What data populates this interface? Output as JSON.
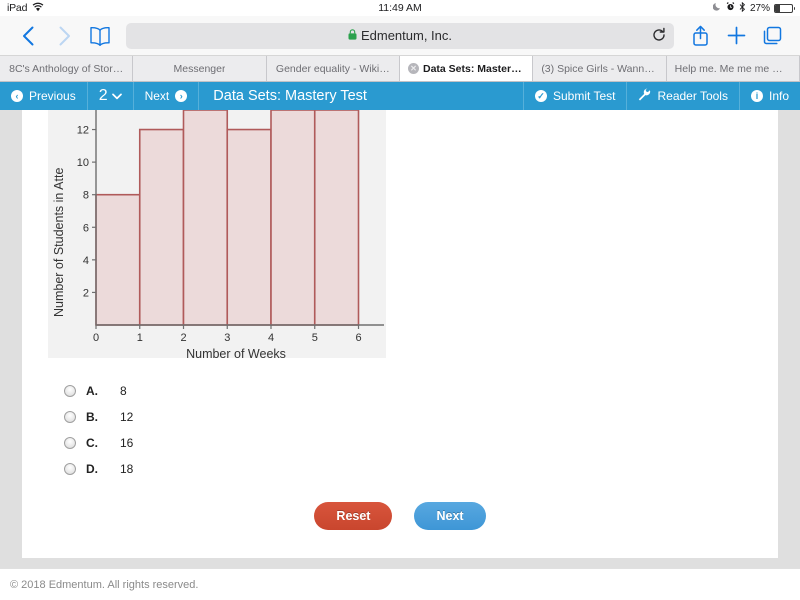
{
  "status_bar": {
    "device": "iPad",
    "wifi_icon": "wifi-icon",
    "time": "11:49 AM",
    "moon_icon": "moon-icon",
    "alarm_icon": "alarm-icon",
    "bluetooth_icon": "bluetooth-icon",
    "battery_percent": "27%",
    "battery_level": 27
  },
  "browser": {
    "back_icon": "chevron-left-icon",
    "forward_icon": "chevron-right-icon",
    "bookmarks_icon": "book-icon",
    "lock_icon": "lock-icon",
    "url_text": "Edmentum, Inc.",
    "reload_icon": "reload-icon",
    "share_icon": "share-icon",
    "newtab_icon": "plus-icon",
    "tabs_icon": "tabs-icon",
    "tabs": [
      {
        "label": "8C's Anthology of Stor…",
        "active": false,
        "has_close": false
      },
      {
        "label": "Messenger",
        "active": false,
        "has_close": false
      },
      {
        "label": "Gender equality - Wiki…",
        "active": false,
        "has_close": false
      },
      {
        "label": "Data Sets: Mastery…",
        "active": true,
        "has_close": true
      },
      {
        "label": "(3) Spice Girls - Wanna…",
        "active": false,
        "has_close": false
      },
      {
        "label": "Help me. Me me me m…",
        "active": false,
        "has_close": false
      }
    ]
  },
  "app_toolbar": {
    "accent_color": "#2a9ad0",
    "previous_label": "Previous",
    "previous_icon": "arrow-left-circle-icon",
    "page_number": "2",
    "page_dropdown_icon": "chevron-down-icon",
    "next_label": "Next",
    "next_icon": "arrow-right-circle-icon",
    "title": "Data Sets: Mastery Test",
    "submit_label": "Submit Test",
    "submit_icon": "check-circle-icon",
    "reader_tools_label": "Reader Tools",
    "reader_tools_icon": "wrench-icon",
    "info_label": "Info",
    "info_icon": "info-circle-icon"
  },
  "chart_data": {
    "type": "bar",
    "title": "",
    "xlabel": "Number of Weeks",
    "ylabel": "Number of Students in Atte",
    "ylabel_truncated": true,
    "categories": [
      "0-1",
      "1-2",
      "2-3",
      "3-4",
      "4-5",
      "5-6"
    ],
    "bin_edges": [
      0,
      1,
      2,
      3,
      4,
      5,
      6
    ],
    "values": [
      8,
      12,
      14,
      12,
      14,
      14
    ],
    "clipped_above": [
      false,
      false,
      true,
      false,
      true,
      true
    ],
    "xticks": [
      "0",
      "1",
      "2",
      "3",
      "4",
      "5",
      "6"
    ],
    "yticks": [
      "2",
      "4",
      "6",
      "8",
      "10",
      "12"
    ],
    "xlim": [
      0,
      6.4
    ],
    "ylim": [
      0,
      13.2
    ],
    "grid": false,
    "legend": null,
    "bar_fill_color": "#ecdada",
    "bar_edge_color": "#b05a5a",
    "plot_bg_color": "#f2f2f2"
  },
  "question": {
    "options": [
      {
        "letter": "A.",
        "value": "8",
        "selected": false
      },
      {
        "letter": "B.",
        "value": "12",
        "selected": false
      },
      {
        "letter": "C.",
        "value": "16",
        "selected": false
      },
      {
        "letter": "D.",
        "value": "18",
        "selected": false
      }
    ],
    "reset_label": "Reset",
    "next_label": "Next"
  },
  "footer": {
    "copyright": "© 2018 Edmentum. All rights reserved."
  }
}
